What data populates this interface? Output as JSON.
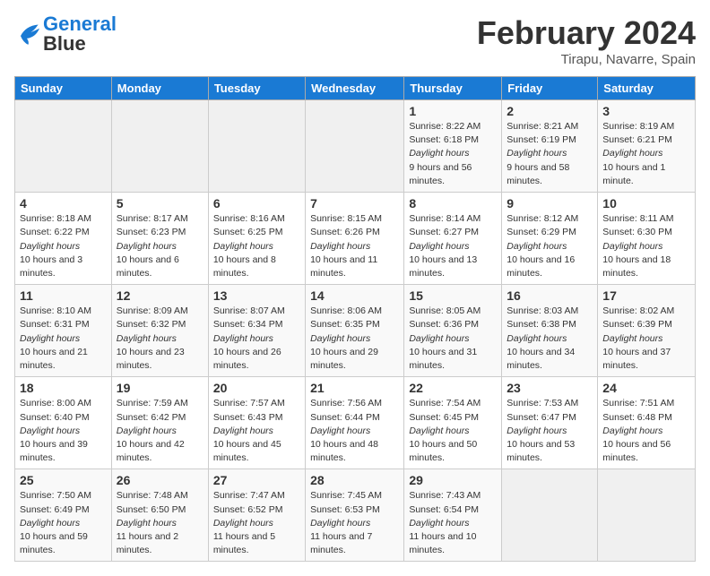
{
  "header": {
    "logo_general": "General",
    "logo_blue": "Blue",
    "month": "February 2024",
    "location": "Tirapu, Navarre, Spain"
  },
  "weekdays": [
    "Sunday",
    "Monday",
    "Tuesday",
    "Wednesday",
    "Thursday",
    "Friday",
    "Saturday"
  ],
  "weeks": [
    [
      {
        "day": "",
        "info": []
      },
      {
        "day": "",
        "info": []
      },
      {
        "day": "",
        "info": []
      },
      {
        "day": "",
        "info": []
      },
      {
        "day": "1",
        "info": [
          "Sunrise: 8:22 AM",
          "Sunset: 6:18 PM",
          "Daylight: 9 hours and 56 minutes."
        ]
      },
      {
        "day": "2",
        "info": [
          "Sunrise: 8:21 AM",
          "Sunset: 6:19 PM",
          "Daylight: 9 hours and 58 minutes."
        ]
      },
      {
        "day": "3",
        "info": [
          "Sunrise: 8:19 AM",
          "Sunset: 6:21 PM",
          "Daylight: 10 hours and 1 minute."
        ]
      }
    ],
    [
      {
        "day": "4",
        "info": [
          "Sunrise: 8:18 AM",
          "Sunset: 6:22 PM",
          "Daylight: 10 hours and 3 minutes."
        ]
      },
      {
        "day": "5",
        "info": [
          "Sunrise: 8:17 AM",
          "Sunset: 6:23 PM",
          "Daylight: 10 hours and 6 minutes."
        ]
      },
      {
        "day": "6",
        "info": [
          "Sunrise: 8:16 AM",
          "Sunset: 6:25 PM",
          "Daylight: 10 hours and 8 minutes."
        ]
      },
      {
        "day": "7",
        "info": [
          "Sunrise: 8:15 AM",
          "Sunset: 6:26 PM",
          "Daylight: 10 hours and 11 minutes."
        ]
      },
      {
        "day": "8",
        "info": [
          "Sunrise: 8:14 AM",
          "Sunset: 6:27 PM",
          "Daylight: 10 hours and 13 minutes."
        ]
      },
      {
        "day": "9",
        "info": [
          "Sunrise: 8:12 AM",
          "Sunset: 6:29 PM",
          "Daylight: 10 hours and 16 minutes."
        ]
      },
      {
        "day": "10",
        "info": [
          "Sunrise: 8:11 AM",
          "Sunset: 6:30 PM",
          "Daylight: 10 hours and 18 minutes."
        ]
      }
    ],
    [
      {
        "day": "11",
        "info": [
          "Sunrise: 8:10 AM",
          "Sunset: 6:31 PM",
          "Daylight: 10 hours and 21 minutes."
        ]
      },
      {
        "day": "12",
        "info": [
          "Sunrise: 8:09 AM",
          "Sunset: 6:32 PM",
          "Daylight: 10 hours and 23 minutes."
        ]
      },
      {
        "day": "13",
        "info": [
          "Sunrise: 8:07 AM",
          "Sunset: 6:34 PM",
          "Daylight: 10 hours and 26 minutes."
        ]
      },
      {
        "day": "14",
        "info": [
          "Sunrise: 8:06 AM",
          "Sunset: 6:35 PM",
          "Daylight: 10 hours and 29 minutes."
        ]
      },
      {
        "day": "15",
        "info": [
          "Sunrise: 8:05 AM",
          "Sunset: 6:36 PM",
          "Daylight: 10 hours and 31 minutes."
        ]
      },
      {
        "day": "16",
        "info": [
          "Sunrise: 8:03 AM",
          "Sunset: 6:38 PM",
          "Daylight: 10 hours and 34 minutes."
        ]
      },
      {
        "day": "17",
        "info": [
          "Sunrise: 8:02 AM",
          "Sunset: 6:39 PM",
          "Daylight: 10 hours and 37 minutes."
        ]
      }
    ],
    [
      {
        "day": "18",
        "info": [
          "Sunrise: 8:00 AM",
          "Sunset: 6:40 PM",
          "Daylight: 10 hours and 39 minutes."
        ]
      },
      {
        "day": "19",
        "info": [
          "Sunrise: 7:59 AM",
          "Sunset: 6:42 PM",
          "Daylight: 10 hours and 42 minutes."
        ]
      },
      {
        "day": "20",
        "info": [
          "Sunrise: 7:57 AM",
          "Sunset: 6:43 PM",
          "Daylight: 10 hours and 45 minutes."
        ]
      },
      {
        "day": "21",
        "info": [
          "Sunrise: 7:56 AM",
          "Sunset: 6:44 PM",
          "Daylight: 10 hours and 48 minutes."
        ]
      },
      {
        "day": "22",
        "info": [
          "Sunrise: 7:54 AM",
          "Sunset: 6:45 PM",
          "Daylight: 10 hours and 50 minutes."
        ]
      },
      {
        "day": "23",
        "info": [
          "Sunrise: 7:53 AM",
          "Sunset: 6:47 PM",
          "Daylight: 10 hours and 53 minutes."
        ]
      },
      {
        "day": "24",
        "info": [
          "Sunrise: 7:51 AM",
          "Sunset: 6:48 PM",
          "Daylight: 10 hours and 56 minutes."
        ]
      }
    ],
    [
      {
        "day": "25",
        "info": [
          "Sunrise: 7:50 AM",
          "Sunset: 6:49 PM",
          "Daylight: 10 hours and 59 minutes."
        ]
      },
      {
        "day": "26",
        "info": [
          "Sunrise: 7:48 AM",
          "Sunset: 6:50 PM",
          "Daylight: 11 hours and 2 minutes."
        ]
      },
      {
        "day": "27",
        "info": [
          "Sunrise: 7:47 AM",
          "Sunset: 6:52 PM",
          "Daylight: 11 hours and 5 minutes."
        ]
      },
      {
        "day": "28",
        "info": [
          "Sunrise: 7:45 AM",
          "Sunset: 6:53 PM",
          "Daylight: 11 hours and 7 minutes."
        ]
      },
      {
        "day": "29",
        "info": [
          "Sunrise: 7:43 AM",
          "Sunset: 6:54 PM",
          "Daylight: 11 hours and 10 minutes."
        ]
      },
      {
        "day": "",
        "info": []
      },
      {
        "day": "",
        "info": []
      }
    ]
  ]
}
